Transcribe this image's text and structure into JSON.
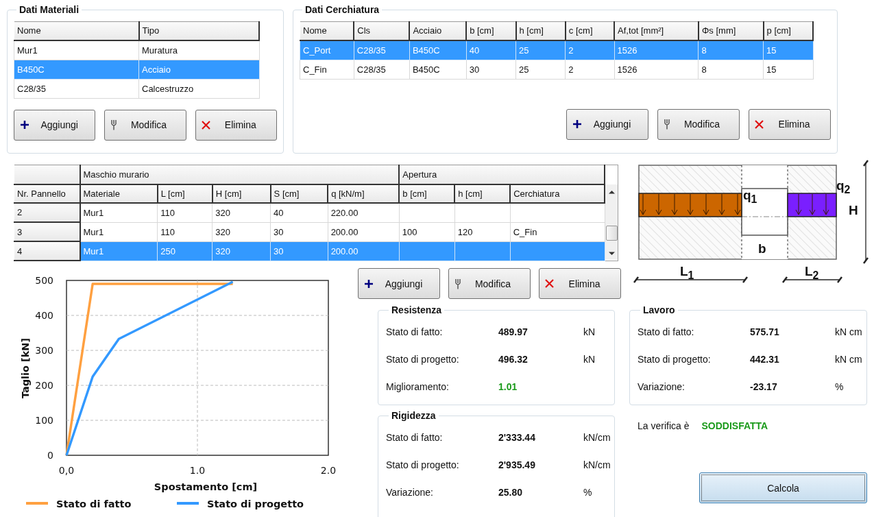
{
  "materials": {
    "title": "Dati Materiali",
    "columns": [
      "Nome",
      "Tipo"
    ],
    "rows": [
      {
        "cells": [
          "Mur1",
          "Muratura"
        ],
        "selected": false
      },
      {
        "cells": [
          "B450C",
          "Acciaio"
        ],
        "selected": true
      },
      {
        "cells": [
          "C28/35",
          "Calcestruzzo"
        ],
        "selected": false
      }
    ],
    "buttons": [
      {
        "label": "Aggiungi",
        "kind": "add"
      },
      {
        "label": "Modifica",
        "kind": "edit"
      },
      {
        "label": "Elimina",
        "kind": "delete"
      }
    ]
  },
  "cerchiatura": {
    "title": "Dati Cerchiatura",
    "columns": [
      "Nome",
      "Cls",
      "Acciaio",
      "b [cm]",
      "h [cm]",
      "c [cm]",
      "Af,tot [mm²]",
      "Φs [mm]",
      "p [cm]"
    ],
    "rows": [
      {
        "cells": [
          "C_Port",
          "C28/35",
          "B450C",
          "40",
          "25",
          "2",
          "1526",
          "8",
          "15"
        ],
        "selected": true
      },
      {
        "cells": [
          "C_Fin",
          "C28/35",
          "B450C",
          "30",
          "25",
          "2",
          "1526",
          "8",
          "15"
        ],
        "selected": false
      }
    ],
    "buttons": [
      {
        "label": "Aggiungi",
        "kind": "add"
      },
      {
        "label": "Modifica",
        "kind": "edit"
      },
      {
        "label": "Elimina",
        "kind": "delete"
      }
    ]
  },
  "panels": {
    "row_header": "Nr. Pannello",
    "groups": [
      {
        "label": "Maschio murario",
        "columns": [
          "Materiale",
          "L [cm]",
          "H [cm]",
          "S [cm]",
          "q [kN/m]"
        ]
      },
      {
        "label": "Apertura",
        "columns": [
          "b [cm]",
          "h [cm]",
          "Cerchiatura"
        ]
      }
    ],
    "rows": [
      {
        "number": "2",
        "cells": [
          "Mur1",
          "110",
          "320",
          "40",
          "220.00",
          null,
          null,
          null
        ],
        "selected": false
      },
      {
        "number": "3",
        "cells": [
          "Mur1",
          "110",
          "320",
          "30",
          "200.00",
          "100",
          "120",
          "C_Fin"
        ],
        "selected": false
      },
      {
        "number": "4",
        "cells": [
          "Mur1",
          "250",
          "320",
          "30",
          "200.00",
          null,
          null,
          null
        ],
        "selected": true
      }
    ],
    "buttons": [
      {
        "label": "Aggiungi",
        "kind": "add"
      },
      {
        "label": "Modifica",
        "kind": "edit"
      },
      {
        "label": "Elimina",
        "kind": "delete"
      }
    ]
  },
  "diagram": {
    "load_left": "q$_{1}$",
    "load_right": "q$_{2}$",
    "height": "H",
    "opening_width": "b",
    "left_length": "L$_{1}$",
    "right_length": "L$_{2}$"
  },
  "chart": {
    "chart_data": {
      "type": "line",
      "xlabel": "Spostamento [cm]",
      "ylabel": "Taglio [kN]",
      "xlim": [
        0,
        2
      ],
      "ylim": [
        0,
        500
      ],
      "xticks": [
        {
          "value": 0,
          "label": "0,0"
        },
        {
          "value": 1,
          "label": "1.0"
        },
        {
          "value": 2,
          "label": "2.0"
        }
      ],
      "yticks": [
        {
          "value": 0,
          "label": "0"
        },
        {
          "value": 100,
          "label": "100"
        },
        {
          "value": 200,
          "label": "200"
        },
        {
          "value": 300,
          "label": "300"
        },
        {
          "value": 400,
          "label": "400"
        },
        {
          "value": 500,
          "label": "500"
        }
      ],
      "grid": true,
      "legend": true,
      "x": [
        0,
        0.2,
        0.4,
        1.27
      ],
      "series": [
        {
          "name": "Stato di fatto",
          "color": "#ffa040",
          "values": [
            0,
            490,
            490,
            490
          ]
        },
        {
          "name": "Stato di progetto",
          "color": "#3399ff",
          "values": [
            0,
            225,
            333,
            496
          ]
        }
      ]
    }
  },
  "resistenza": {
    "title": "Resistenza",
    "rows": [
      {
        "label": "Stato di fatto:",
        "value": "489.97",
        "unit": "kN",
        "highlight": false
      },
      {
        "label": "Stato di progetto:",
        "value": "496.32",
        "unit": "kN",
        "highlight": false
      },
      {
        "label": "Miglioramento:",
        "value": "1.01",
        "highlight": true
      }
    ]
  },
  "rigidezza": {
    "title": "Rigidezza",
    "rows": [
      {
        "label": "Stato di fatto:",
        "value": "2'333.44",
        "unit": "kN/cm",
        "highlight": false
      },
      {
        "label": "Stato di progetto:",
        "value": "2'935.49",
        "unit": "kN/cm",
        "highlight": false
      },
      {
        "label": "Variazione:",
        "value": "25.80",
        "unit": "%",
        "highlight": false
      }
    ]
  },
  "lavoro": {
    "title": "Lavoro",
    "rows": [
      {
        "label": "Stato di fatto:",
        "value": "575.71",
        "unit": "kN cm",
        "highlight": false
      },
      {
        "label": "Stato di progetto:",
        "value": "442.31",
        "unit": "kN cm",
        "highlight": false
      },
      {
        "label": "Variazione:",
        "value": "-23.17",
        "unit": "%",
        "highlight": false
      }
    ]
  },
  "verifica": {
    "label": "La verifica è",
    "result": "SODDISFATTA",
    "passed": true
  },
  "calculate": {
    "label": "Calcola",
    "focused": true
  }
}
